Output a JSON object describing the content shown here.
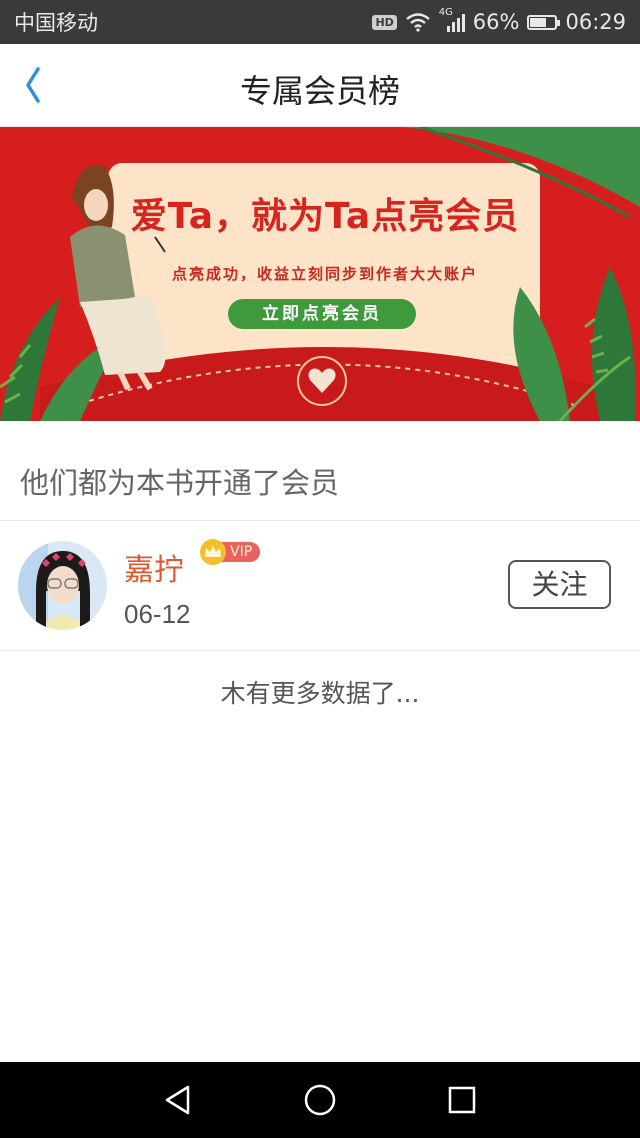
{
  "status_bar": {
    "carrier": "中国移动",
    "hd": "HD",
    "network": "4G",
    "battery": "66%",
    "battery_level": 0.66,
    "time": "06:29"
  },
  "header": {
    "title": "专属会员榜"
  },
  "banner": {
    "headline": "爱Ta，就为Ta点亮会员",
    "subtitle": "点亮成功，收益立刻同步到作者大大账户",
    "button_label": "立即点亮会员",
    "colors": {
      "background": "#d61e1e",
      "card": "#fde3c8",
      "button": "#3f9a3d"
    }
  },
  "section": {
    "heading": "他们都为本书开通了会员"
  },
  "members": [
    {
      "name": "嘉拧",
      "badge": "VIP",
      "date": "06-12",
      "follow_label": "关注"
    }
  ],
  "footer": {
    "no_more": "木有更多数据了..."
  },
  "nav_bar": {
    "icons": [
      "back-triangle-icon",
      "home-circle-icon",
      "recents-square-icon"
    ]
  }
}
